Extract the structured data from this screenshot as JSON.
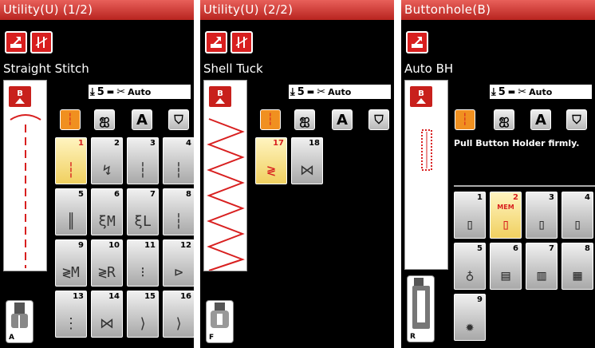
{
  "screens": [
    {
      "title": "Utility(U) (1/2)",
      "stitch_name": "Straight Stitch",
      "presser_foot": "A",
      "thread_tension": "5",
      "auto_label": "Auto",
      "category_letter": "A",
      "stitches": [
        {
          "num": "1",
          "icon": "┆"
        },
        {
          "num": "2",
          "icon": "↯"
        },
        {
          "num": "3",
          "icon": "┆"
        },
        {
          "num": "4",
          "icon": "┆"
        },
        {
          "num": "5",
          "icon": "║"
        },
        {
          "num": "6",
          "icon": "ξM"
        },
        {
          "num": "7",
          "icon": "ξL"
        },
        {
          "num": "8",
          "icon": "┆"
        },
        {
          "num": "9",
          "icon": "≷M"
        },
        {
          "num": "10",
          "icon": "≷R"
        },
        {
          "num": "11",
          "icon": "⁝"
        },
        {
          "num": "12",
          "icon": "⊳"
        },
        {
          "num": "13",
          "icon": "⋮"
        },
        {
          "num": "14",
          "icon": "⋈"
        },
        {
          "num": "15",
          "icon": "⟩"
        },
        {
          "num": "16",
          "icon": "⟩"
        }
      ]
    },
    {
      "title": "Utility(U) (2/2)",
      "stitch_name": "Shell Tuck",
      "presser_foot": "F",
      "thread_tension": "5",
      "auto_label": "Auto",
      "category_letter": "A",
      "stitches": [
        {
          "num": "17",
          "icon": "≷"
        },
        {
          "num": "18",
          "icon": "⋈"
        }
      ]
    },
    {
      "title": "Buttonhole(B)",
      "stitch_name": "Auto BH",
      "presser_foot": "R",
      "thread_tension": "5",
      "auto_label": "Auto",
      "category_letter": "A",
      "message": "Pull Button Holder firmly.",
      "mem_label": "MEM",
      "stitches": [
        {
          "num": "1",
          "icon": "▯"
        },
        {
          "num": "2",
          "icon": "▯"
        },
        {
          "num": "3",
          "icon": "▯"
        },
        {
          "num": "4",
          "icon": "▯"
        },
        {
          "num": "5",
          "icon": "♁"
        },
        {
          "num": "6",
          "icon": "▤"
        },
        {
          "num": "7",
          "icon": "▥"
        },
        {
          "num": "8",
          "icon": "▦"
        },
        {
          "num": "9",
          "icon": "✹"
        }
      ]
    }
  ],
  "colors": {
    "title_red": "#c8342e",
    "accent_orange": "#f09020",
    "selected_yellow": "#f0d060",
    "stitch_red": "#d81f1f"
  }
}
